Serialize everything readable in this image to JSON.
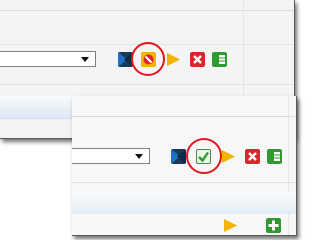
{
  "screens": {
    "before": {
      "toolbar_icons": [
        "expand-icon",
        "cancel-icon",
        "play-icon",
        "delete-icon",
        "grid-icon"
      ],
      "highlighted_icon": "cancel-icon"
    },
    "after": {
      "toolbar_icons": [
        "expand-icon",
        "confirm-icon",
        "play-icon",
        "delete-icon",
        "grid-icon"
      ],
      "highlighted_icon": "confirm-icon",
      "secondary_icons": [
        "play-icon",
        "add-icon"
      ]
    }
  },
  "colors": {
    "highlight_ring": "#e3161f",
    "blue_icon": "#1f6fc5",
    "yellow_icon": "#f2b400",
    "red_icon": "#d9252b",
    "green_icon": "#2f9a2f"
  }
}
